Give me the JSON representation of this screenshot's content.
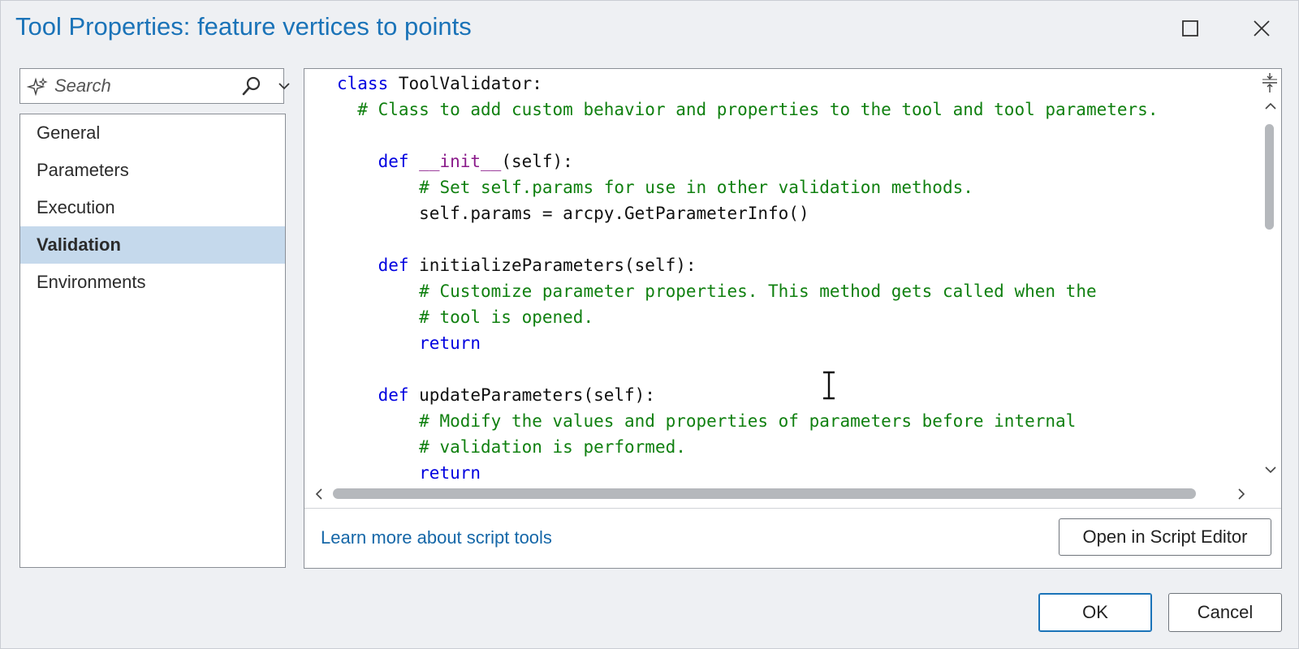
{
  "window": {
    "title": "Tool Properties: feature vertices to points"
  },
  "search": {
    "placeholder": "Search"
  },
  "nav": {
    "items": [
      {
        "label": "General"
      },
      {
        "label": "Parameters"
      },
      {
        "label": "Execution"
      },
      {
        "label": "Validation"
      },
      {
        "label": "Environments"
      }
    ],
    "selected": "Validation"
  },
  "code": {
    "lines": [
      {
        "indent": 0,
        "tokens": [
          {
            "t": "kw",
            "v": "class"
          },
          {
            "t": "tx",
            "v": " ToolValidator:"
          }
        ]
      },
      {
        "indent": 1,
        "tokens": [
          {
            "t": "cm",
            "v": "# Class to add custom behavior and properties to the tool and tool parameters."
          }
        ]
      },
      {
        "indent": 0,
        "tokens": []
      },
      {
        "indent": 2,
        "tokens": [
          {
            "t": "kw",
            "v": "def"
          },
          {
            "t": "tx",
            "v": " "
          },
          {
            "t": "dn",
            "v": "__init__"
          },
          {
            "t": "tx",
            "v": "(self):"
          }
        ]
      },
      {
        "indent": 4,
        "tokens": [
          {
            "t": "cm",
            "v": "# Set self.params for use in other validation methods."
          }
        ]
      },
      {
        "indent": 4,
        "tokens": [
          {
            "t": "tx",
            "v": "self.params = arcpy.GetParameterInfo()"
          }
        ]
      },
      {
        "indent": 0,
        "tokens": []
      },
      {
        "indent": 2,
        "tokens": [
          {
            "t": "kw",
            "v": "def"
          },
          {
            "t": "tx",
            "v": " initializeParameters(self):"
          }
        ]
      },
      {
        "indent": 4,
        "tokens": [
          {
            "t": "cm",
            "v": "# Customize parameter properties. This method gets called when the"
          }
        ]
      },
      {
        "indent": 4,
        "tokens": [
          {
            "t": "cm",
            "v": "# tool is opened."
          }
        ]
      },
      {
        "indent": 4,
        "tokens": [
          {
            "t": "kw",
            "v": "return"
          }
        ]
      },
      {
        "indent": 0,
        "tokens": []
      },
      {
        "indent": 2,
        "tokens": [
          {
            "t": "kw",
            "v": "def"
          },
          {
            "t": "tx",
            "v": " updateParameters(self):"
          }
        ]
      },
      {
        "indent": 4,
        "tokens": [
          {
            "t": "cm",
            "v": "# Modify the values and properties of parameters before internal"
          }
        ]
      },
      {
        "indent": 4,
        "tokens": [
          {
            "t": "cm",
            "v": "# validation is performed."
          }
        ]
      },
      {
        "indent": 4,
        "tokens": [
          {
            "t": "kw",
            "v": "return"
          }
        ]
      }
    ]
  },
  "footer": {
    "learn_more": "Learn more about script tools",
    "open_script_editor": "Open in Script Editor"
  },
  "buttons": {
    "ok": "OK",
    "cancel": "Cancel"
  },
  "colors": {
    "accent": "#1a73b8",
    "keyword": "#0000e0",
    "comment": "#108010",
    "dunder": "#8a1a8a",
    "selected_bg": "#c5d9ec"
  },
  "icons": {
    "maximize": "maximize-icon",
    "close": "close-icon",
    "search_assist": "sparkle-icon",
    "search": "search-icon",
    "dropdown": "chevron-down-icon"
  }
}
